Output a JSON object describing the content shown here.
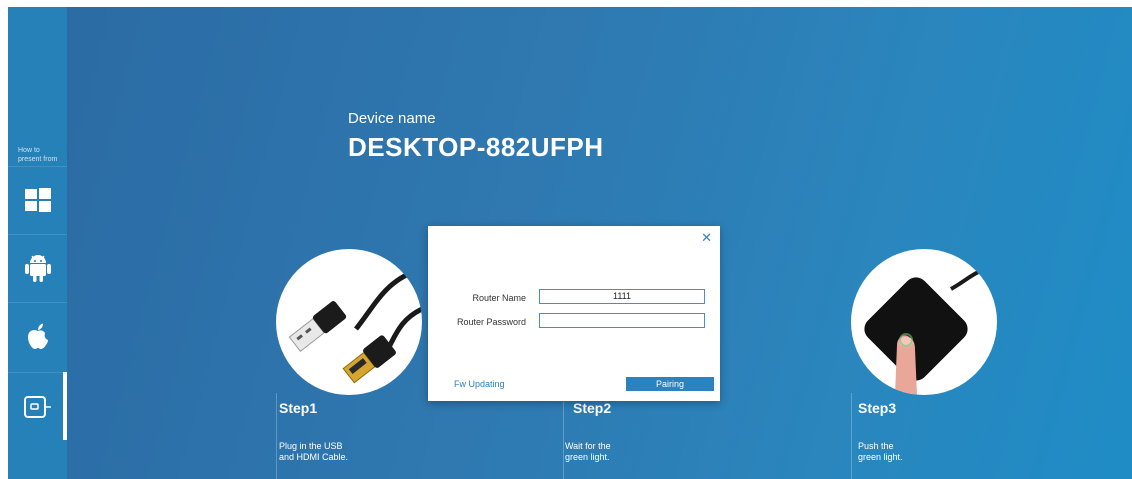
{
  "sidebar": {
    "howto_label": "How to\npresent from",
    "items": [
      {
        "icon": "windows-icon"
      },
      {
        "icon": "android-icon"
      },
      {
        "icon": "apple-icon"
      },
      {
        "icon": "button-device-icon"
      }
    ]
  },
  "device": {
    "label": "Device name",
    "name": "DESKTOP-882UFPH"
  },
  "steps": [
    {
      "title": "Step1",
      "desc_line1": "Plug in the USB",
      "desc_line2": "and HDMI Cable."
    },
    {
      "title": "Step2",
      "desc_line1": "Wait for the",
      "desc_line2": "green light."
    },
    {
      "title": "Step3",
      "desc_line1": "Push the",
      "desc_line2": "green light."
    }
  ],
  "dialog": {
    "close_icon": "close-icon",
    "router_name_label": "Router Name",
    "router_name_value": "1111",
    "router_password_label": "Router Password",
    "router_password_value": "",
    "fw_link": "Fw Updating",
    "pairing_button": "Pairing"
  },
  "colors": {
    "background": "#2b6aa3",
    "sidebar": "#2681b8",
    "accent": "#2a82c0"
  }
}
